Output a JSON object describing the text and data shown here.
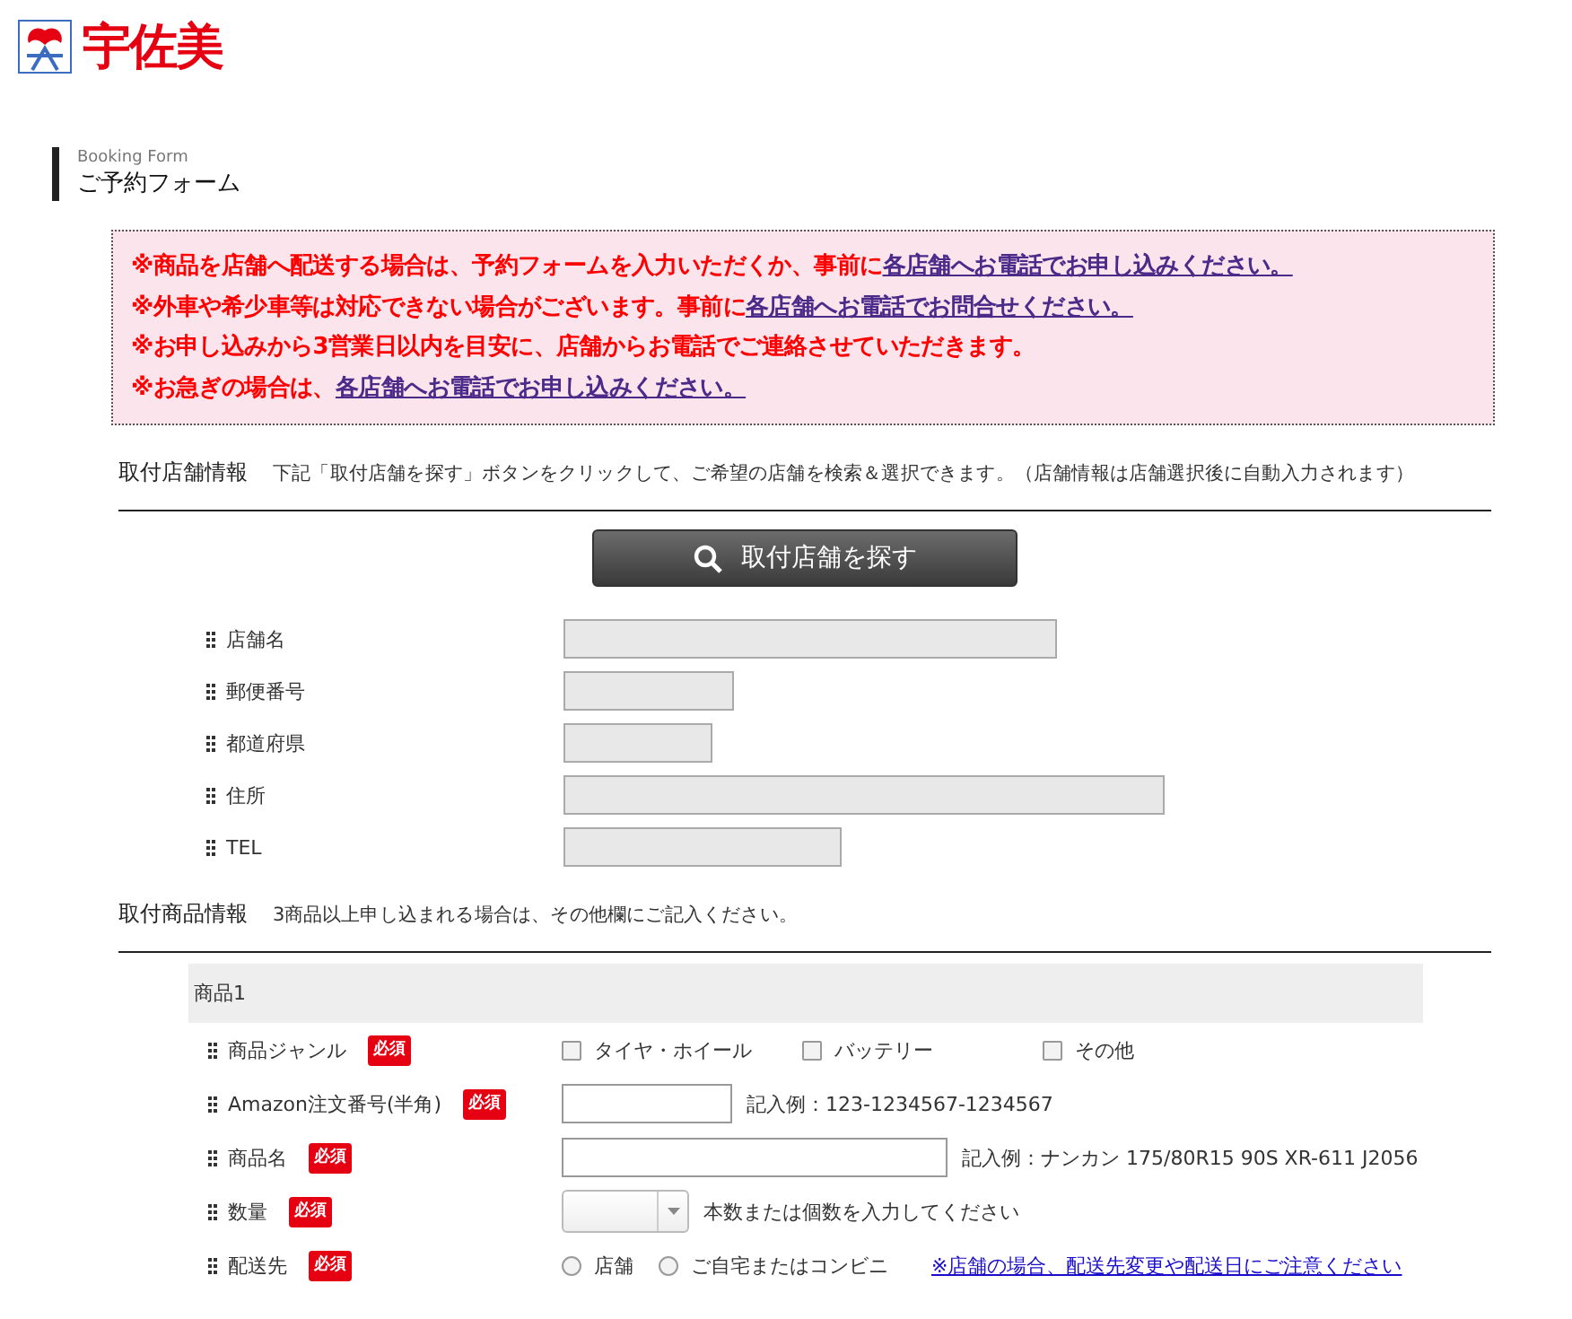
{
  "logo": {
    "name": "宇佐美"
  },
  "heading": {
    "subtitle": "Booking Form",
    "title": "ご予約フォーム"
  },
  "notices": [
    {
      "text": "※商品を店舗へ配送する場合は、予約フォームを入力いただくか、事前に",
      "link": "各店舗へお電話でお申し込みください。"
    },
    {
      "text": "※外車や希少車等は対応できない場合がございます。事前に",
      "link": "各店舗へお電話でお問合せください。"
    },
    {
      "text": "※お申し込みから3営業日以内を目安に、店舗からお電話でご連絡させていただきます。"
    },
    {
      "text": "※お急ぎの場合は、",
      "link": "各店舗へお電話でお申し込みください。"
    }
  ],
  "store_section": {
    "title": "取付店舗情報",
    "note": "下記「取付店舗を探す」ボタンをクリックして、ご希望の店舗を検索＆選択できます。（店舗情報は店舗選択後に自動入力されます）",
    "button": "取付店舗を探す",
    "fields": [
      {
        "label": "店舗名",
        "kind": "wide"
      },
      {
        "label": "郵便番号",
        "kind": "short"
      },
      {
        "label": "都道府県",
        "kind": "tiny"
      },
      {
        "label": "住所",
        "kind": "full"
      },
      {
        "label": "TEL",
        "kind": "medium"
      }
    ]
  },
  "product_section": {
    "title": "取付商品情報",
    "note": "3商品以上申し込まれる場合は、その他欄にご記入ください。",
    "product_title": "商品1",
    "rows": [
      {
        "label": "商品ジャンル",
        "required": "必須",
        "kind": "checkboxes",
        "options": [
          {
            "label": "タイヤ・ホイール",
            "checked": false
          },
          {
            "label": "バッテリー",
            "checked": false
          },
          {
            "label": "その他",
            "checked": false
          }
        ]
      },
      {
        "label": "Amazon注文番号(半角)",
        "required": "必須",
        "kind": "short_text",
        "hint": "記入例：123-1234567-1234567"
      },
      {
        "label": "商品名",
        "required": "必須",
        "kind": "long_text",
        "hint": "記入例：ナンカン 175/80R15 90S XR-611 J2056"
      },
      {
        "label": "数量",
        "required": "必須",
        "kind": "select",
        "hint": "本数または個数を入力してください"
      },
      {
        "label": "配送先",
        "required": "必須",
        "kind": "radios",
        "options": [
          {
            "label": "店舗",
            "selected": false
          },
          {
            "label": "ご自宅またはコンビニ",
            "selected": false
          }
        ],
        "link": "※店舗の場合、配送先変更や配送日にご注意ください"
      }
    ]
  }
}
